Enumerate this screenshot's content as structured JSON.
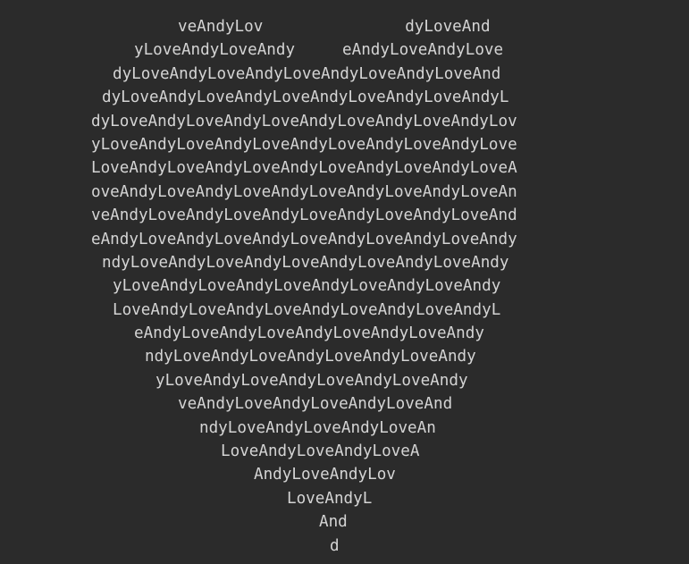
{
  "output": {
    "lines": [
      "veAndyLov               dyLoveAnd",
      "yLoveAndyLoveAndy     eAndyLoveAndyLove",
      "dyLoveAndyLoveAndyLoveAndyLoveAndyLoveAnd",
      "dyLoveAndyLoveAndyLoveAndyLoveAndyLoveAndyL",
      "dyLoveAndyLoveAndyLoveAndyLoveAndyLoveAndyLov",
      "yLoveAndyLoveAndyLoveAndyLoveAndyLoveAndyLove",
      "LoveAndyLoveAndyLoveAndyLoveAndyLoveAndyLoveA",
      "oveAndyLoveAndyLoveAndyLoveAndyLoveAndyLoveAn",
      "veAndyLoveAndyLoveAndyLoveAndyLoveAndyLoveAnd",
      "eAndyLoveAndyLoveAndyLoveAndyLoveAndyLoveAndy",
      "ndyLoveAndyLoveAndyLoveAndyLoveAndyLoveAndy",
      "yLoveAndyLoveAndyLoveAndyLoveAndyLoveAndy",
      "LoveAndyLoveAndyLoveAndyLoveAndyLoveAndyL",
      "eAndyLoveAndyLoveAndyLoveAndyLoveAndy",
      "ndyLoveAndyLoveAndyLoveAndyLoveAndy",
      "yLoveAndyLoveAndyLoveAndyLoveAndy",
      "veAndyLoveAndyLoveAndyLoveAnd",
      "ndyLoveAndyLoveAndyLoveAn",
      "LoveAndyLoveAndyLoveA",
      "AndyLoveAndyLov",
      "LoveAndyL",
      "And",
      "d"
    ]
  },
  "colors": {
    "background": "#2b2b2b",
    "text": "#d4d4d4"
  }
}
